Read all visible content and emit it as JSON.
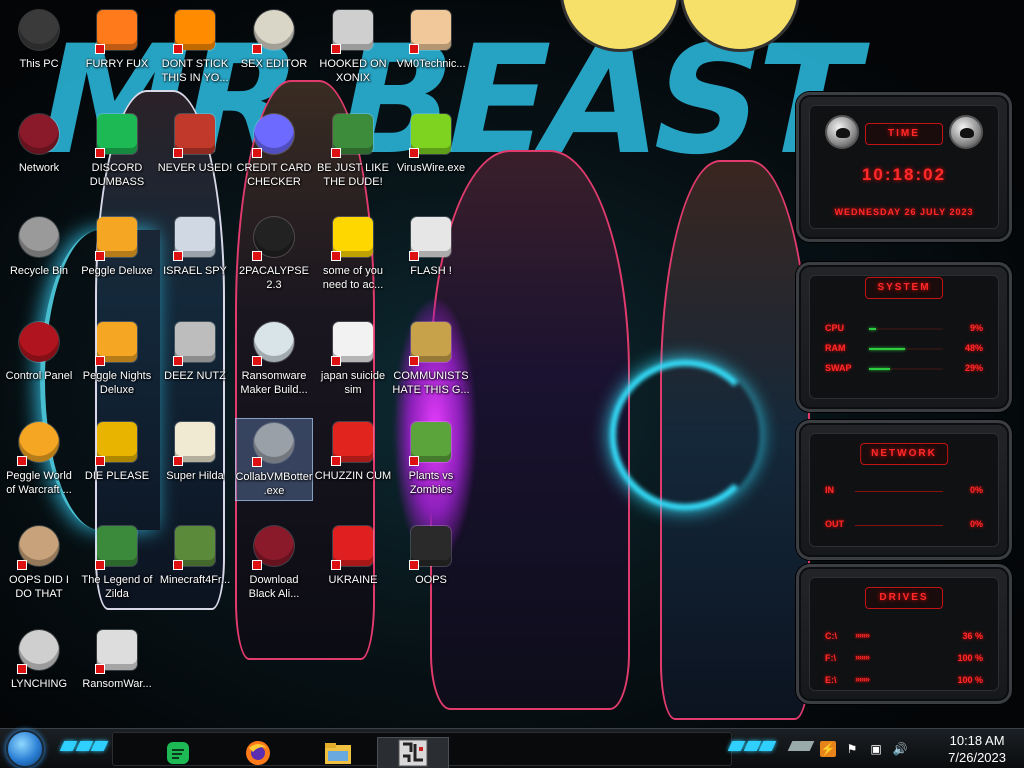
{
  "desktop": {
    "icons": [
      {
        "label": "This PC",
        "icon": "computer-icon",
        "color": "#3a3a3a"
      },
      {
        "label": "FURRY FUX",
        "icon": "firefox-icon",
        "color": "#ff7a1a"
      },
      {
        "label": "DONT STICK THIS IN YO...",
        "icon": "vlc-cone-icon",
        "color": "#ff8c00"
      },
      {
        "label": "SEX EDITOR",
        "icon": "hex-editor-icon",
        "color": "#d9d6c8"
      },
      {
        "label": "HOOKED ON XONIX",
        "icon": "maze-game-icon",
        "color": "#cfcfcf"
      },
      {
        "label": "VM0Technic...",
        "icon": "doctor-icon",
        "color": "#f0c89a"
      },
      {
        "label": "Network",
        "icon": "alienware-icon",
        "color": "#8a1a2a"
      },
      {
        "label": "DISCORD DUMBASS",
        "icon": "green-chat-icon",
        "color": "#1db954"
      },
      {
        "label": "NEVER USED!",
        "icon": "devcpp-icon",
        "color": "#c0392b"
      },
      {
        "label": "CREDIT CARD CHECKER",
        "icon": "credit-card-icon",
        "color": "#6d6aff"
      },
      {
        "label": "BE JUST LIKE THE DUDE!",
        "icon": "santa-elf-icon",
        "color": "#3c8c3c"
      },
      {
        "label": "VirusWire.exe",
        "icon": "lime-icon",
        "color": "#7ed321"
      },
      {
        "label": "Recycle Bin",
        "icon": "recycle-bin-icon",
        "color": "#9a9a9a"
      },
      {
        "label": "Peggle Deluxe",
        "icon": "peggle-icon",
        "color": "#f5a623"
      },
      {
        "label": "ISRAEL SPY",
        "icon": "folder-window-icon",
        "color": "#cfd8e3"
      },
      {
        "label": "2PACALYPSE 2.3",
        "icon": "terminal-icon",
        "color": "#222222"
      },
      {
        "label": "some of you need to ac...",
        "icon": "beaver-icon",
        "color": "#ffd700"
      },
      {
        "label": "FLASH !",
        "icon": "flash-file-icon",
        "color": "#e6e6e6"
      },
      {
        "label": "Control Panel",
        "icon": "control-panel-icon",
        "color": "#b0141e"
      },
      {
        "label": "Peggle Nights Deluxe",
        "icon": "peggle-icon",
        "color": "#f5a623"
      },
      {
        "label": "DEEZ NUTZ",
        "icon": "stacked-windows-icon",
        "color": "#bdbdbd"
      },
      {
        "label": "Ransomware Maker Build...",
        "icon": "app-window-icon",
        "color": "#d8e4e8"
      },
      {
        "label": "japan suicide sim",
        "icon": "document-icon",
        "color": "#f2f2f2"
      },
      {
        "label": "COMMUNISTS HATE THIS G...",
        "icon": "money-bag-icon",
        "color": "#c8a24a"
      },
      {
        "label": "Peggle World of Warcraft ...",
        "icon": "peggle-icon",
        "color": "#f5a623"
      },
      {
        "label": "DIE PLEASE",
        "icon": "director-icon",
        "color": "#e8b400"
      },
      {
        "label": "Super Hilda",
        "icon": "pixel-art-icon",
        "color": "#f0ead2"
      },
      {
        "label": "CollabVMBotter.exe",
        "icon": "shark-app-icon",
        "color": "#9aa0a8"
      },
      {
        "label": "CHUZZIN CUM",
        "icon": "chuzzle-icon",
        "color": "#e1241e"
      },
      {
        "label": "Plants vs Zombies",
        "icon": "plant-icon",
        "color": "#5ba33b"
      },
      {
        "label": "OOPS DID I DO THAT",
        "icon": "portrait-icon",
        "color": "#c8a27a"
      },
      {
        "label": "The Legend of Zilda",
        "icon": "pixel-hero-icon",
        "color": "#3b8a3b"
      },
      {
        "label": "Minecraft4Fr...",
        "icon": "grass-block-icon",
        "color": "#5b8a3a"
      },
      {
        "label": "Download Black Ali...",
        "icon": "alienware-icon",
        "color": "#8a1a2a"
      },
      {
        "label": "UKRAINE",
        "icon": "radiation-icon",
        "color": "#e02020"
      },
      {
        "label": "OOPS",
        "icon": "monitor-icon",
        "color": "#2a2a2a"
      },
      {
        "label": "LYNCHING",
        "icon": "noose-icon",
        "color": "#cfcfcf"
      },
      {
        "label": "RansomWar...",
        "icon": "skull-icon",
        "color": "#dddddd"
      }
    ],
    "selected_label": "CollabVMBotter.exe"
  },
  "wallpaper": {
    "title_text": "MR BEAST"
  },
  "gadgets": {
    "time": {
      "header": "TIME",
      "clock": "10:18:02",
      "date": "WEDNESDAY 26 JULY 2023"
    },
    "system": {
      "header": "SYSTEM",
      "rows": [
        {
          "key": "CPU",
          "value": "9%",
          "fraction": 0.09
        },
        {
          "key": "RAM",
          "value": "48%",
          "fraction": 0.48
        },
        {
          "key": "SWAP",
          "value": "29%",
          "fraction": 0.29
        }
      ]
    },
    "network": {
      "header": "NETWORK",
      "rows": [
        {
          "key": "IN",
          "value": "0%"
        },
        {
          "key": "OUT",
          "value": "0%"
        }
      ]
    },
    "drives": {
      "header": "DRIVES",
      "rows": [
        {
          "key": "C:\\",
          "value": "36 %"
        },
        {
          "key": "F:\\",
          "value": "100 %"
        },
        {
          "key": "E:\\",
          "value": "100 %"
        }
      ]
    }
  },
  "taskbar": {
    "pinned": [
      {
        "name": "green-chat-icon"
      },
      {
        "name": "firefox-icon"
      },
      {
        "name": "file-explorer-icon"
      },
      {
        "name": "maze-game-icon",
        "active": true
      }
    ],
    "clock": {
      "time": "10:18 AM",
      "date": "7/26/2023"
    }
  }
}
